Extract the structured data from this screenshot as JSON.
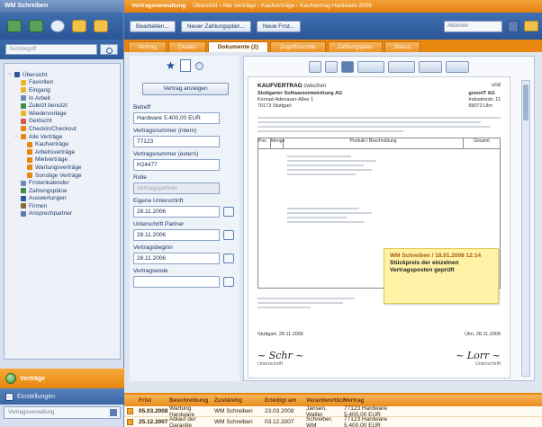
{
  "sidebar": {
    "title": "WM Schreiben",
    "search_placeholder": "Suchbegriff",
    "tree": [
      {
        "label": "Übersicht",
        "level": 0,
        "icon": "#2b5aa0",
        "expander": "−"
      },
      {
        "label": "Favoriten",
        "level": 1,
        "icon": "#f0b428"
      },
      {
        "label": "Eingang",
        "level": 1,
        "icon": "#f0b428"
      },
      {
        "label": "In Arbeit",
        "level": 1,
        "icon": "#6e8bb6"
      },
      {
        "label": "Zuletzt benutzt",
        "level": 1,
        "icon": "#3f8f3f"
      },
      {
        "label": "Wiedervorlage",
        "level": 1,
        "icon": "#f0b428"
      },
      {
        "label": "Gelöscht",
        "level": 1,
        "icon": "#d9534f"
      },
      {
        "label": "Checkin/Checkout",
        "level": 1,
        "icon": "#e8870f"
      },
      {
        "label": "Alle Verträge",
        "level": 1,
        "icon": "#e8870f",
        "expander": "−"
      },
      {
        "label": "Kaufverträge",
        "level": 2,
        "icon": "#e8870f"
      },
      {
        "label": "Arbeitsverträge",
        "level": 2,
        "icon": "#e8870f"
      },
      {
        "label": "Mietverträge",
        "level": 2,
        "icon": "#e8870f"
      },
      {
        "label": "Wartungsverträge",
        "level": 2,
        "icon": "#e8870f"
      },
      {
        "label": "Sonstige Verträge",
        "level": 2,
        "icon": "#e8870f"
      },
      {
        "label": "Fristenkalender",
        "level": 1,
        "icon": "#6e8bb6"
      },
      {
        "label": "Zahlungspläne",
        "level": 1,
        "icon": "#3f8f3f"
      },
      {
        "label": "Auswertungen",
        "level": 1,
        "icon": "#2b5aa0"
      },
      {
        "label": "Firmen",
        "level": 1,
        "icon": "#8a6d3b"
      },
      {
        "label": "Ansprechpartner",
        "level": 1,
        "icon": "#5a7bb0"
      }
    ],
    "bottom_orange": "Verträge",
    "bottom_blue": "Einstellungen",
    "bottom_select": "Vertragsverwaltung"
  },
  "main": {
    "title_app": "Vertragsverwaltung",
    "title_path": "Übersicht › Alle Verträge › Kaufverträge › Kaufvertrag Hardware 2008",
    "toolbar": {
      "edit": "Bearbeiten...",
      "new_payment": "Neuer Zahlungsplan...",
      "new_deadline": "Neue Frist...",
      "dropdown": "Aktionen"
    },
    "tabs": [
      "Vertrag",
      "Details",
      "Dokumente (2)",
      "Zugriffsrechte",
      "Zahlungsplan",
      "Status"
    ],
    "active_tab": 2
  },
  "form": {
    "button": "Vertrag anzeigen",
    "fields": [
      {
        "label": "Betreff",
        "value": "Hardware 5.400,00 EUR",
        "calendar": false,
        "disabled": false
      },
      {
        "label": "Vertragsnummer (intern)",
        "value": "77123",
        "calendar": false,
        "disabled": false
      },
      {
        "label": "Vertragsnummer (extern)",
        "value": "H24477",
        "calendar": false,
        "disabled": false
      },
      {
        "label": "Rolle",
        "value": "Vertragspartner",
        "calendar": false,
        "disabled": true
      },
      {
        "label": "Eigene Unterschrift",
        "value": "28.11.2006",
        "calendar": true,
        "disabled": false
      },
      {
        "label": "Unterschrift Partner",
        "value": "28.11.2006",
        "calendar": true,
        "disabled": false
      },
      {
        "label": "Vertragsbeginn",
        "value": "28.11.2006",
        "calendar": true,
        "disabled": false
      },
      {
        "label": "Vertragsende",
        "value": "",
        "calendar": true,
        "disabled": false
      }
    ]
  },
  "document": {
    "heading": "KAUFVERTRAG",
    "heading_suffix": "zwischen",
    "and": "und",
    "party1": [
      "Stuttgarter Softwareentwicklung AG",
      "Konrad-Adenauer-Allee 1",
      "70173 Stuttgart"
    ],
    "party2": [
      "greenIT AG",
      "Industriestr. 11",
      "89073 Ulm"
    ],
    "table_headers": [
      "Pos.",
      "Menge",
      "Produkt / Beschreibung",
      "Gesamt"
    ],
    "sticky_note": [
      "WM Schreiben / 18.01.2008 12:14",
      "Stückpreis der einzelnen",
      "Vertragsposten geprüft"
    ],
    "sig_left": "Stuttgart, 28.11.2006",
    "sig_right": "Ulm, 28.11.2006",
    "sig_label": "Unterschrift"
  },
  "table": {
    "headers": [
      "Frist",
      "Beschreibung",
      "Zuständig",
      "Erledigt am",
      "Verantwortlich",
      "Vertrag"
    ],
    "rows": [
      [
        "05.03.2008",
        "Wartung Hardware",
        "WM Schreiben",
        "23.03.2008",
        "Jansen, Walter",
        "77123 Hardware 5.400,00 EUR"
      ],
      [
        "25.12.2007",
        "Ablauf der Garantie",
        "WM Schreiben",
        "03.12.2007",
        "Schreiber, WM",
        "77123 Hardware 5.400,00 EUR"
      ]
    ]
  }
}
